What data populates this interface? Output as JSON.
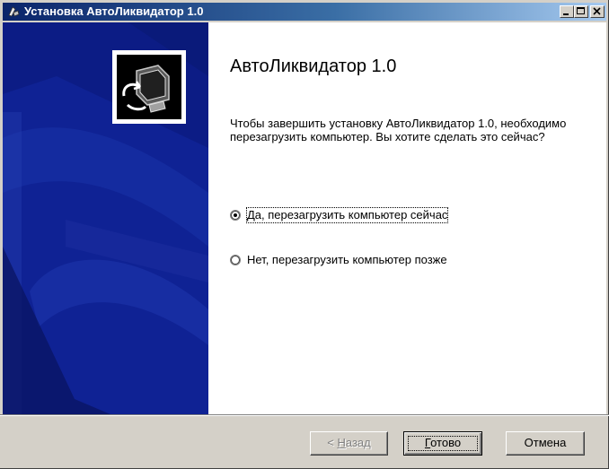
{
  "window": {
    "title": "Установка АвтоЛиквидатор 1.0"
  },
  "icons": {
    "title": "installer-icon",
    "minimize": "minimize-icon",
    "maximize": "maximize-icon",
    "close": "close-icon",
    "logo": "computer-install-icon"
  },
  "content": {
    "heading": "АвтоЛиквидатор 1.0",
    "description": "Чтобы завершить установку АвтоЛиквидатор 1.0, необходимо перезагрузить компьютер. Вы хотите сделать это сейчас?",
    "options": [
      {
        "label": "Да, перезагрузить компьютер сейчас",
        "selected": true
      },
      {
        "label": "Нет, перезагрузить компьютер позже",
        "selected": false
      }
    ]
  },
  "buttons": {
    "back": {
      "prefix": "< ",
      "accel": "Н",
      "rest": "азад",
      "enabled": false
    },
    "finish": {
      "accel": "Г",
      "rest": "отово"
    },
    "cancel": "Отмена"
  },
  "colors": {
    "sidebar": "#0c1c85",
    "titlebar_start": "#0a246a",
    "titlebar_end": "#a6caf0"
  }
}
